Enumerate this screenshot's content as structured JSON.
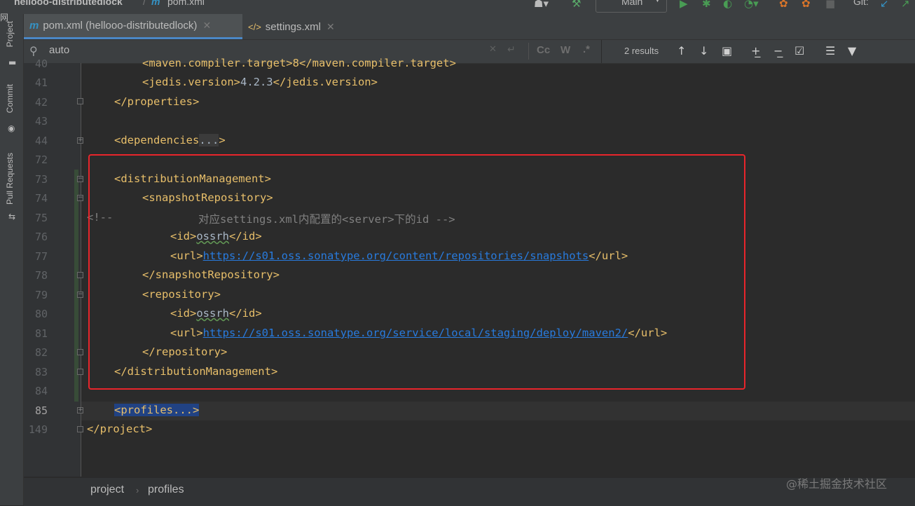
{
  "topbar": {
    "project_name": "hellooo-distributedlock",
    "separator": "/",
    "file_icon": "m",
    "file_name": "pom.xml",
    "run_config": "Main",
    "git_label": "Git:"
  },
  "left_strip": {
    "panel_char": "网",
    "items": [
      "Project",
      "Commit",
      "Pull Requests"
    ]
  },
  "tabs": [
    {
      "icon": "m",
      "label": "pom.xml (hellooo-distributedlock)",
      "active": true
    },
    {
      "icon": "xml-file-icon",
      "label": "settings.xml",
      "active": false
    }
  ],
  "search": {
    "query": "auto",
    "results": "2 results",
    "match_case": "Cc",
    "words": "W",
    "regex": ".*"
  },
  "editor": {
    "lines": [
      {
        "num": "40",
        "text": "<maven.compiler.target>8</maven.compiler.target>"
      },
      {
        "num": "41",
        "tag_open": "<jedis.version>",
        "value": "4.2.3",
        "tag_close": "</jedis.version>"
      },
      {
        "num": "42",
        "text": "</properties>"
      },
      {
        "num": "43",
        "text": ""
      },
      {
        "num": "44",
        "tag_open": "<dependencies",
        "folded": "...",
        "tag_close": ">"
      },
      {
        "num": "72",
        "text": ""
      },
      {
        "num": "73",
        "text": "<distributionManagement>"
      },
      {
        "num": "74",
        "text": "<snapshotRepository>"
      },
      {
        "num": "75",
        "comment_start": "<!--",
        "comment_body": "对应settings.xml内配置的<server>下的id -->"
      },
      {
        "num": "76",
        "tag_open": "<id>",
        "value": "ossrh",
        "tag_close": "</id>"
      },
      {
        "num": "77",
        "tag_open": "<url>",
        "url": "https://s01.oss.sonatype.org/content/repositories/snapshots",
        "tag_close": "</url>"
      },
      {
        "num": "78",
        "text": "</snapshotRepository>"
      },
      {
        "num": "79",
        "text": "<repository>"
      },
      {
        "num": "80",
        "tag_open": "<id>",
        "value": "ossrh",
        "tag_close": "</id>"
      },
      {
        "num": "81",
        "tag_open": "<url>",
        "url": "https://s01.oss.sonatype.org/service/local/staging/deploy/maven2/",
        "tag_close": "</url>"
      },
      {
        "num": "82",
        "text": "</repository>"
      },
      {
        "num": "83",
        "text": "</distributionManagement>"
      },
      {
        "num": "84",
        "text": ""
      },
      {
        "num": "85",
        "text": "<profiles...>"
      },
      {
        "num": "149",
        "text": "</project>"
      }
    ]
  },
  "breadcrumbs": [
    "project",
    "profiles"
  ],
  "watermark": "@稀土掘金技术社区",
  "colors": {
    "tag": "#e8bf6a",
    "text": "#a9b7c6",
    "url": "#287bde",
    "comment": "#808080",
    "highlight_box": "#e8252b",
    "selection": "#214283"
  }
}
